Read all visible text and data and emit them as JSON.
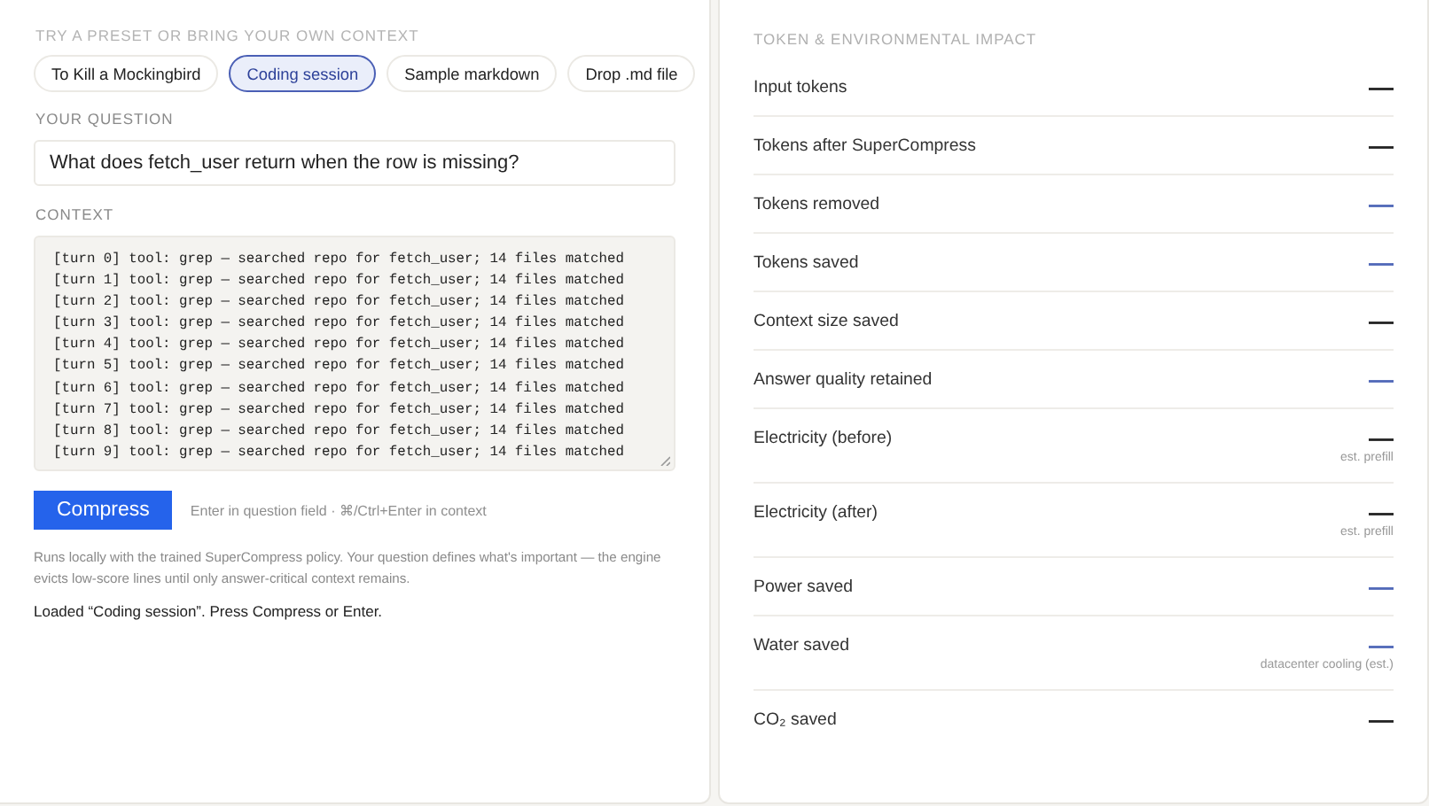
{
  "input_panel": {
    "presets_label": "TRY A PRESET OR BRING YOUR OWN CONTEXT",
    "presets": [
      {
        "label": "To Kill a Mockingbird",
        "selected": false
      },
      {
        "label": "Coding session",
        "selected": true
      },
      {
        "label": "Sample markdown",
        "selected": false
      },
      {
        "label": "Drop .md file",
        "selected": false
      }
    ],
    "question_label": "YOUR QUESTION",
    "question": {
      "value": "What does fetch_user return when the row is missing?"
    },
    "context_label": "CONTEXT",
    "context_lines": [
      "[turn 0] tool: grep — searched repo for fetch_user; 14 files matched",
      "[turn 1] tool: grep — searched repo for fetch_user; 14 files matched",
      "[turn 2] tool: grep — searched repo for fetch_user; 14 files matched",
      "[turn 3] tool: grep — searched repo for fetch_user; 14 files matched",
      "[turn 4] tool: grep — searched repo for fetch_user; 14 files matched",
      "[turn 5] tool: grep — searched repo for fetch_user; 14 files matched",
      "[turn 6] tool: grep — searched repo for fetch_user; 14 files matched",
      "[turn 7] tool: grep — searched repo for fetch_user; 14 files matched",
      "[turn 8] tool: grep — searched repo for fetch_user; 14 files matched",
      "[turn 9] tool: grep — searched repo for fetch_user; 14 files matched"
    ],
    "compress_button": "Compress",
    "shortcut_hint": "Enter in question field · ⌘/Ctrl+Enter in context",
    "description": "Runs locally with the trained SuperCompress policy. Your question defines what's important — the engine evicts low-score lines until only answer-critical context remains.",
    "status": "Loaded “Coding session”. Press Compress or Enter."
  },
  "impact_panel": {
    "title": "TOKEN & ENVIRONMENTAL IMPACT",
    "metrics": [
      {
        "label": "Input tokens",
        "value": "—",
        "accent": false
      },
      {
        "label": "Tokens after SuperCompress",
        "value": "—",
        "accent": false
      },
      {
        "label": "Tokens removed",
        "value": "—",
        "accent": true
      },
      {
        "label": "Tokens saved",
        "value": "—",
        "accent": true
      },
      {
        "label": "Context size saved",
        "value": "—",
        "accent": false
      },
      {
        "label": "Answer quality retained",
        "value": "—",
        "accent": true
      },
      {
        "label": "Electricity (before)",
        "value": "—",
        "accent": false,
        "note": "est. prefill"
      },
      {
        "label": "Electricity (after)",
        "value": "—",
        "accent": false,
        "note": "est. prefill"
      },
      {
        "label": "Power saved",
        "value": "—",
        "accent": true
      },
      {
        "label": "Water saved",
        "value": "—",
        "accent": true,
        "note": "datacenter cooling (est.)"
      },
      {
        "label": "CO₂ saved",
        "value": "—",
        "accent": false
      }
    ]
  }
}
